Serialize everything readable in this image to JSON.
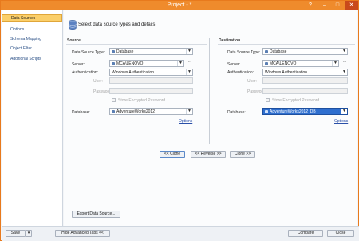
{
  "titlebar": {
    "title": "Project - *",
    "help": "?",
    "minimize": "–",
    "maximize": "□",
    "close": "✕"
  },
  "sidebar": {
    "items": [
      {
        "label": "Data Sources"
      },
      {
        "label": "Options"
      },
      {
        "label": "Schema Mapping"
      },
      {
        "label": "Object Filter"
      },
      {
        "label": "Additional Scripts"
      }
    ]
  },
  "header": {
    "text": "Select data source types and details"
  },
  "source": {
    "title": "Source",
    "type_label": "Data Source Type:",
    "type_value": "Database",
    "server_label": "Server:",
    "server_value": "MCA\\LENOVO",
    "auth_label": "Authentication:",
    "auth_value": "Windows Authentication",
    "user_label": "User:",
    "password_label": "Password:",
    "store_password": "Store Encrypted Password",
    "database_label": "Database:",
    "database_value": "AdventureWorks2012",
    "options": "Options"
  },
  "destination": {
    "title": "Destination",
    "type_label": "Data Source Type:",
    "type_value": "Database",
    "server_label": "Server:",
    "server_value": "MCA\\LENOVO",
    "auth_label": "Authentication:",
    "auth_value": "Windows Authentication",
    "user_label": "User:",
    "password_label": "Password:",
    "store_password": "Store Encrypted Password",
    "database_label": "Database:",
    "database_value": "AdventureWorks2012_DB",
    "options": "Options"
  },
  "actions": {
    "clone_left": "<< Clone",
    "reverse": "<< Reverse >>",
    "clone_right": "Clone >>"
  },
  "export_button": "Export Data Source...",
  "bottom": {
    "save": "Save",
    "save_dropdown": "▾",
    "hide_tabs": "Hide Advanced Tabs <<",
    "compare": "Compare",
    "close": "Close"
  },
  "colors": {
    "accent": "#ef8b2c",
    "selected_nav": "#fbcf6a",
    "link": "#2a4fa8"
  }
}
